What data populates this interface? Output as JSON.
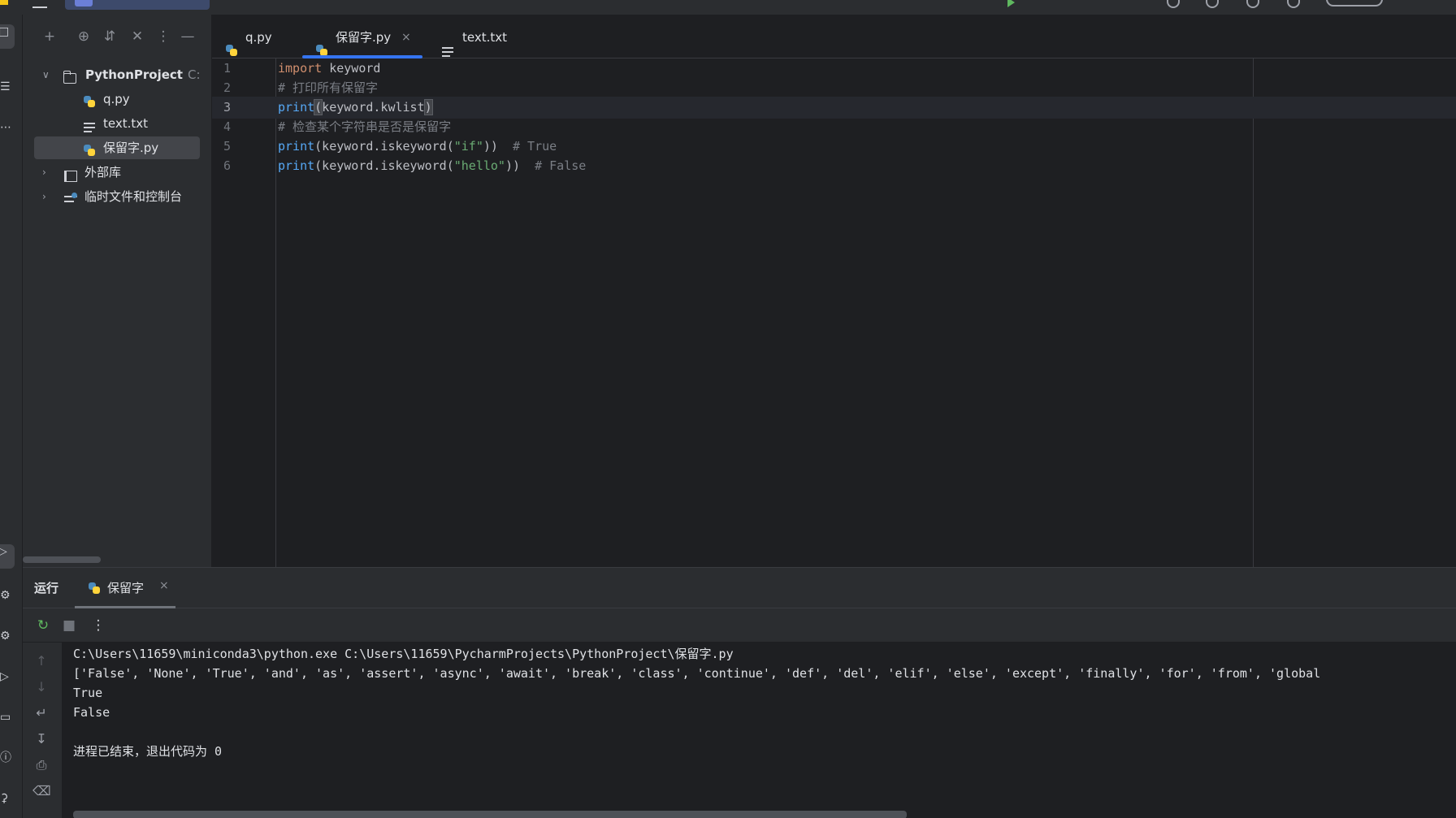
{
  "project_panel": {
    "tree": [
      {
        "label": "PythonProject",
        "sublabel": "C:\\User",
        "type": "folder",
        "expanded": true
      },
      {
        "label": "q.py",
        "type": "python"
      },
      {
        "label": "text.txt",
        "type": "text"
      },
      {
        "label": "保留字.py",
        "type": "python",
        "selected": true
      },
      {
        "label": "外部库",
        "type": "library",
        "expanded": false
      },
      {
        "label": "临时文件和控制台",
        "type": "scratch",
        "expanded": false
      }
    ]
  },
  "editor": {
    "tabs": [
      {
        "label": "q.py",
        "icon": "python-file-icon"
      },
      {
        "label": "保留字.py",
        "icon": "python-file-icon",
        "active": true,
        "close": "×"
      },
      {
        "label": "text.txt",
        "icon": "text-file-icon"
      }
    ],
    "lines": [
      {
        "number": "1",
        "segments": [
          {
            "text": "import",
            "kind": "keyword"
          },
          {
            "text": " keyword",
            "kind": "plain"
          }
        ]
      },
      {
        "number": "2",
        "segments": [
          {
            "text": "# 打印所有保留字",
            "kind": "comment"
          }
        ]
      },
      {
        "number": "3",
        "current": true,
        "segments": [
          {
            "text": "print",
            "kind": "function"
          },
          {
            "text": "(",
            "kind": "paren"
          },
          {
            "text": "keyword.kwlist",
            "kind": "plain"
          },
          {
            "text": ")",
            "kind": "paren"
          }
        ]
      },
      {
        "number": "4",
        "segments": [
          {
            "text": "# 检查某个字符串是否是保留字",
            "kind": "comment"
          }
        ]
      },
      {
        "number": "5",
        "segments": [
          {
            "text": "print",
            "kind": "function"
          },
          {
            "text": "(keyword.iskeyword(",
            "kind": "plain"
          },
          {
            "text": "\"if\"",
            "kind": "string"
          },
          {
            "text": "))  ",
            "kind": "plain"
          },
          {
            "text": "# True",
            "kind": "comment"
          }
        ]
      },
      {
        "number": "6",
        "segments": [
          {
            "text": "print",
            "kind": "function"
          },
          {
            "text": "(keyword.iskeyword(",
            "kind": "plain"
          },
          {
            "text": "\"hello\"",
            "kind": "string"
          },
          {
            "text": "))  ",
            "kind": "plain"
          },
          {
            "text": "# False",
            "kind": "comment"
          }
        ]
      }
    ]
  },
  "run_panel": {
    "title": "运行",
    "tab_label": "保留字",
    "tab_close": "×",
    "console_lines": [
      "C:\\Users\\11659\\miniconda3\\python.exe C:\\Users\\11659\\PycharmProjects\\PythonProject\\保留字.py",
      "['False', 'None', 'True', 'and', 'as', 'assert', 'async', 'await', 'break', 'class', 'continue', 'def', 'del', 'elif', 'else', 'except', 'finally', 'for', 'from', 'global",
      "True",
      "False",
      "",
      "进程已结束，退出代码为 0"
    ]
  },
  "colors": {
    "accent": "#3574f0",
    "keyword": "#cf8e6d",
    "function": "#56a8f5",
    "string": "#6aab73",
    "comment": "#7a7e85",
    "background": "#1e1f22",
    "panel": "#2b2d30"
  }
}
